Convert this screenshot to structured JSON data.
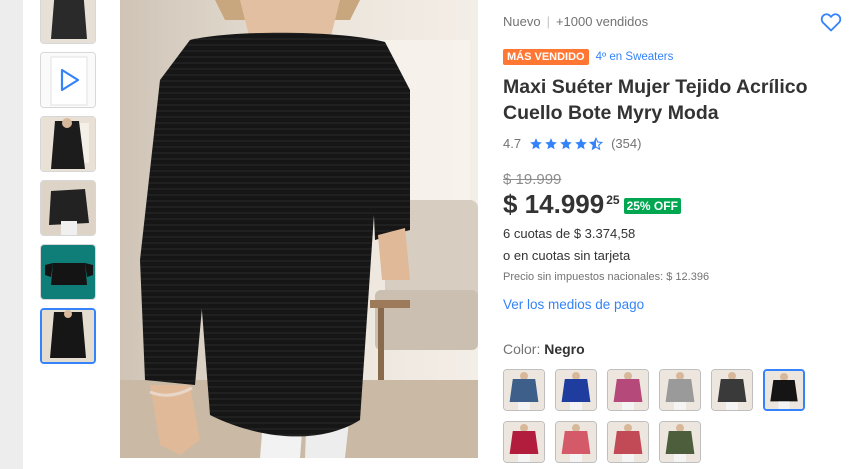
{
  "product": {
    "condition": "Nuevo",
    "separator": "|",
    "sold": "+1000 vendidos",
    "best_seller_badge": "MÁS VENDIDO",
    "ranking": "4º en Sweaters",
    "title": "Maxi Suéter Mujer Tejido Acrílico Cuello Bote Myry Moda",
    "rating_value": "4.7",
    "rating_stars": 4.7,
    "review_count": "(354)",
    "old_price": "$ 19.999",
    "price_main": "$ 14.999",
    "price_cents": "25",
    "discount": "25% OFF",
    "installments": "6 cuotas de $ 3.374,58",
    "no_card": "o en cuotas sin tarjeta",
    "tax_note": "Precio sin impuestos nacionales: $ 12.396",
    "payment_link": "Ver los medios de pago",
    "color_label": "Color: ",
    "color_value": "Negro"
  },
  "thumbnails": [
    {
      "icon": "image-thumbnail",
      "color": "#2a2a2a"
    },
    {
      "icon": "play-video-icon",
      "color": "#3483fa"
    },
    {
      "icon": "image-thumbnail",
      "color": "#1c1c1c"
    },
    {
      "icon": "image-thumbnail",
      "color": "#222222"
    },
    {
      "icon": "image-thumbnail",
      "color": "#0f7d78"
    },
    {
      "icon": "image-thumbnail",
      "color": "#161616",
      "selected": true
    }
  ],
  "swatches": [
    {
      "color": "#3d5f8a"
    },
    {
      "color": "#1f3d9e"
    },
    {
      "color": "#b54a7a"
    },
    {
      "color": "#9a9a9a"
    },
    {
      "color": "#3a3a3a"
    },
    {
      "color": "#151515",
      "selected": true
    },
    {
      "color": "#b21d3e"
    },
    {
      "color": "#d45a6a"
    },
    {
      "color": "#c24a56"
    },
    {
      "color": "#4d5e3c"
    }
  ],
  "colors": {
    "accent": "#3483fa",
    "best_seller": "#ff7733",
    "discount": "#00a650"
  }
}
